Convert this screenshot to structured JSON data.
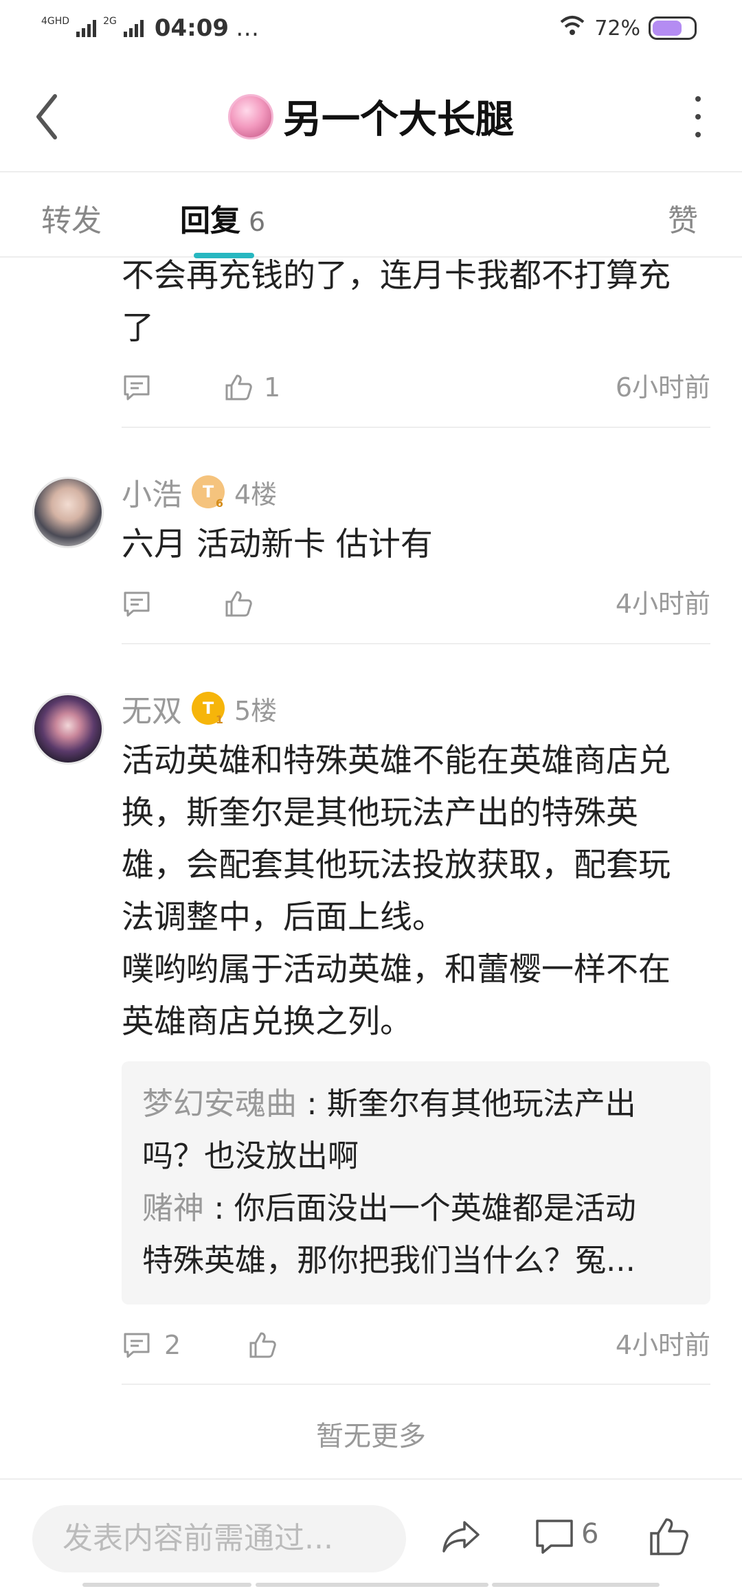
{
  "status": {
    "sig1_tag": "4GHD",
    "sig2_tag": "2G",
    "time": "04:09",
    "dots": "…",
    "battery": "72%"
  },
  "header": {
    "title": "另一个大长腿"
  },
  "tabs": {
    "forward": "转发",
    "reply": "回复",
    "reply_count": "6",
    "like": "赞"
  },
  "replies": [
    {
      "text_lines": [
        "不会再充钱的了，连月卡我都不打算充",
        "了"
      ],
      "like_count": "1",
      "time": "6小时前"
    },
    {
      "name": "小浩",
      "badge": "T",
      "badge_level": "6",
      "floor": "4楼",
      "text_lines": [
        "六月 活动新卡 估计有"
      ],
      "time": "4小时前"
    },
    {
      "name": "无双",
      "badge": "T",
      "badge_level": "1",
      "floor": "5楼",
      "text_lines": [
        "活动英雄和特殊英雄不能在英雄商店兑",
        "换，斯奎尔是其他玩法产出的特殊英",
        "雄，会配套其他玩法投放获取，配套玩",
        "法调整中，后面上线。",
        "噗哟哟属于活动英雄，和蕾樱一样不在",
        "英雄商店兑换之列。"
      ],
      "sub_replies": [
        {
          "name": "梦幻安魂曲",
          "sep": " : ",
          "line1": "斯奎尔有其他玩法产出",
          "line2": "吗？也没放出啊"
        },
        {
          "name": "赌神",
          "sep": " : ",
          "line1": "你后面没出一个英雄都是活动",
          "line2": "特殊英雄，那你把我们当什么？冤..."
        }
      ],
      "comment_count": "2",
      "time": "4小时前"
    }
  ],
  "footer": {
    "no_more": "暂无更多"
  },
  "bottom_bar": {
    "placeholder": "发表内容前需通过...",
    "comment_count": "6"
  },
  "colors": {
    "accent": "#27b7c0",
    "badge_light": "#f5c37d",
    "badge_gold": "#f6b50a",
    "battery": "#b48cf2"
  },
  "icons": {
    "back": "chevron-left-icon",
    "more": "more-vertical-icon",
    "comment": "comment-icon",
    "like": "thumbs-up-icon",
    "share": "share-icon"
  }
}
